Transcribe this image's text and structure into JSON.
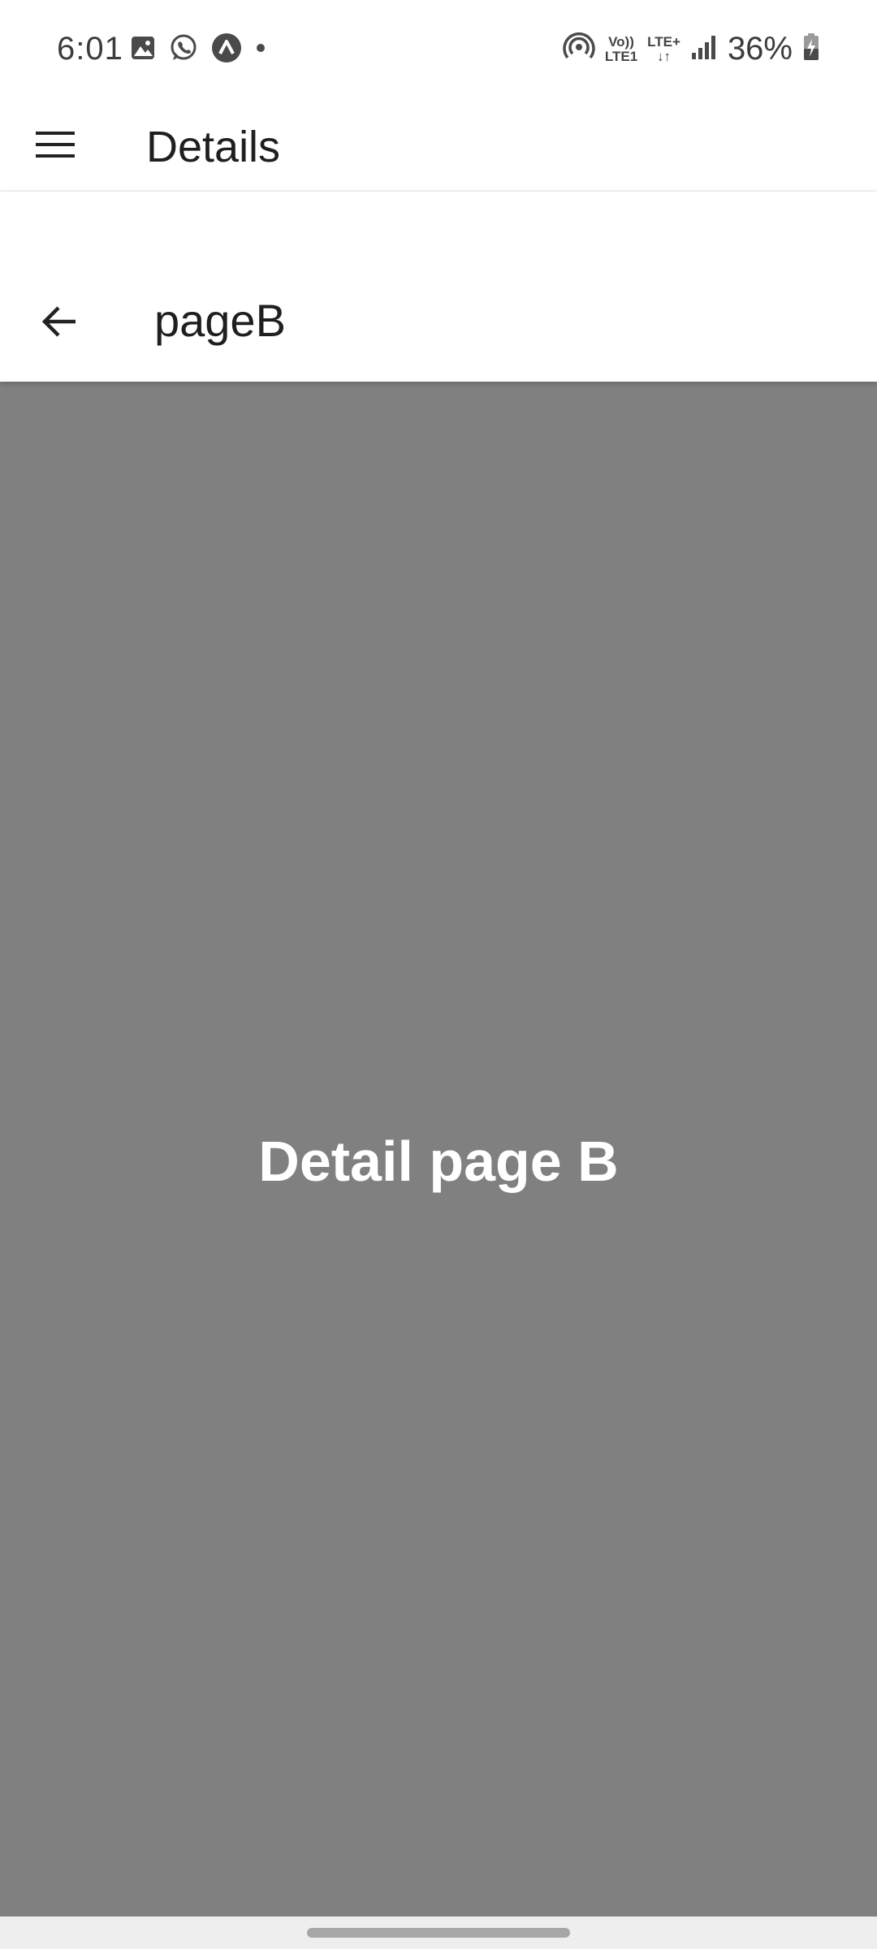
{
  "status_bar": {
    "time": "6:01",
    "volte_line1": "Vo))",
    "volte_line2": "LTE1",
    "lte_line1": "LTE+",
    "lte_line2": "↓↑",
    "battery_percent": "36%",
    "icons": [
      "gallery-icon",
      "whatsapp-icon",
      "app-icon",
      "dot-icon",
      "hotspot-icon",
      "signal-icon",
      "battery-charging-icon"
    ]
  },
  "top_bar": {
    "title": "Details",
    "menu_icon": "hamburger-menu-icon"
  },
  "sub_bar": {
    "title": "pageB",
    "back_icon": "back-arrow-icon"
  },
  "content": {
    "text": "Detail page B",
    "background": "#808080"
  }
}
